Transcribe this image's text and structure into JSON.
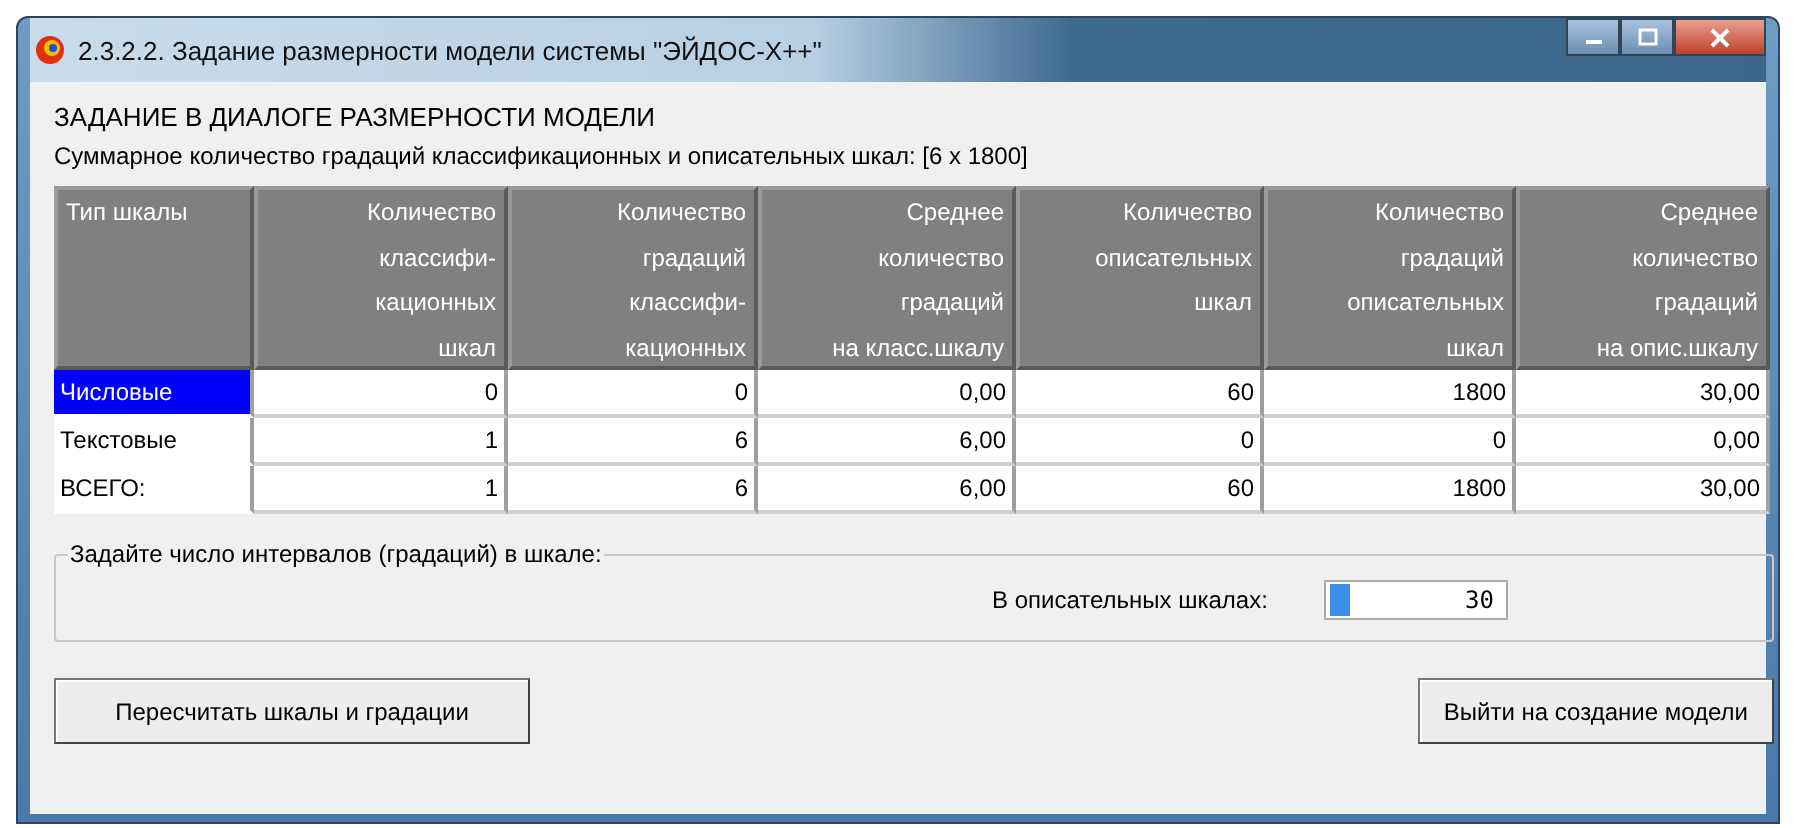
{
  "window": {
    "title": "2.3.2.2. Задание размерности модели системы \"ЭЙДОС-X++\""
  },
  "heading": "ЗАДАНИЕ В ДИАЛОГЕ РАЗМЕРНОСТИ МОДЕЛИ",
  "summary": "Суммарное количество градаций классификационных и описательных шкал: [6 x 1800]",
  "table": {
    "columns": [
      "Тип шкалы",
      "Количество\nклассифи-\nкационных\nшкал",
      "Количество\nградаций\nклассифи-\nкационных",
      "Среднее\nколичество\nградаций\nна класс.шкалу",
      "Количество\nописательных\nшкал",
      "Количество\nградаций\nописательных\nшкал",
      "Среднее\nколичество\nградаций\nна опис.шкалу"
    ],
    "rows": [
      {
        "selected": true,
        "cells": [
          "Числовые",
          "0",
          "0",
          "0,00",
          "60",
          "1800",
          "30,00"
        ]
      },
      {
        "selected": false,
        "cells": [
          "Текстовые",
          "1",
          "6",
          "6,00",
          "0",
          "0",
          "0,00"
        ]
      },
      {
        "selected": false,
        "cells": [
          "ВСЕГО:",
          "1",
          "6",
          "6,00",
          "60",
          "1800",
          "30,00"
        ]
      }
    ]
  },
  "group": {
    "title": "Задайте число интервалов (градаций) в шкале:",
    "field_label": "В описательных шкалах:",
    "field_value": "30"
  },
  "buttons": [
    "Пересчитать шкалы и градации",
    "Выйти на создание модели"
  ]
}
